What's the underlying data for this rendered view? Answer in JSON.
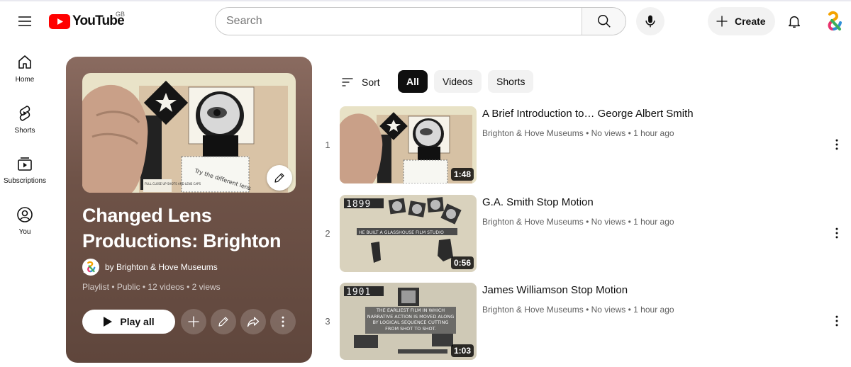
{
  "header": {
    "logo_text": "YouTube",
    "region": "GB",
    "search_placeholder": "Search",
    "create_label": "Create"
  },
  "sidebar": {
    "items": [
      {
        "label": "Home"
      },
      {
        "label": "Shorts"
      },
      {
        "label": "Subscriptions"
      },
      {
        "label": "You"
      }
    ]
  },
  "playlist": {
    "title": "Changed Lens Productions: Brighton ...",
    "owner": "by Brighton & Hove Museums",
    "meta": "Playlist • Public • 12 videos • 2 views",
    "play_all_label": "Play all"
  },
  "filters": {
    "sort_label": "Sort",
    "chips": [
      "All",
      "Videos",
      "Shorts"
    ],
    "active": "All"
  },
  "videos": [
    {
      "index": "1",
      "title": "A Brief Introduction to… George Albert Smith",
      "channel": "Brighton & Hove Museums",
      "views": "No views",
      "age": "1 hour ago",
      "duration": "1:48",
      "year_label": ""
    },
    {
      "index": "2",
      "title": "G.A. Smith Stop Motion",
      "channel": "Brighton & Hove Museums",
      "views": "No views",
      "age": "1 hour ago",
      "duration": "0:56",
      "year_label": "1899",
      "caption": "HE BUILT A GLASSHOUSE FILM STUDIO"
    },
    {
      "index": "3",
      "title": "James Williamson Stop Motion",
      "channel": "Brighton & Hove Museums",
      "views": "No views",
      "age": "1 hour ago",
      "duration": "1:03",
      "year_label": "1901",
      "caption": "THE EARLIEST FILM IN WHICH NARRATIVE ACTION IS MOVED ALONG BY LOGICAL SEQUENCE CUTTING FROM SHOT TO SHOT."
    }
  ],
  "thumb_notes": {
    "handwriting": "Try the different lens",
    "card_caption": "FULL CLOSE UP SHOTS AND LENS CAPS"
  },
  "colors": {
    "brand_red": "#ff0000",
    "hero_bg": "#6f5348",
    "chip_active": "#0f0f0f"
  }
}
